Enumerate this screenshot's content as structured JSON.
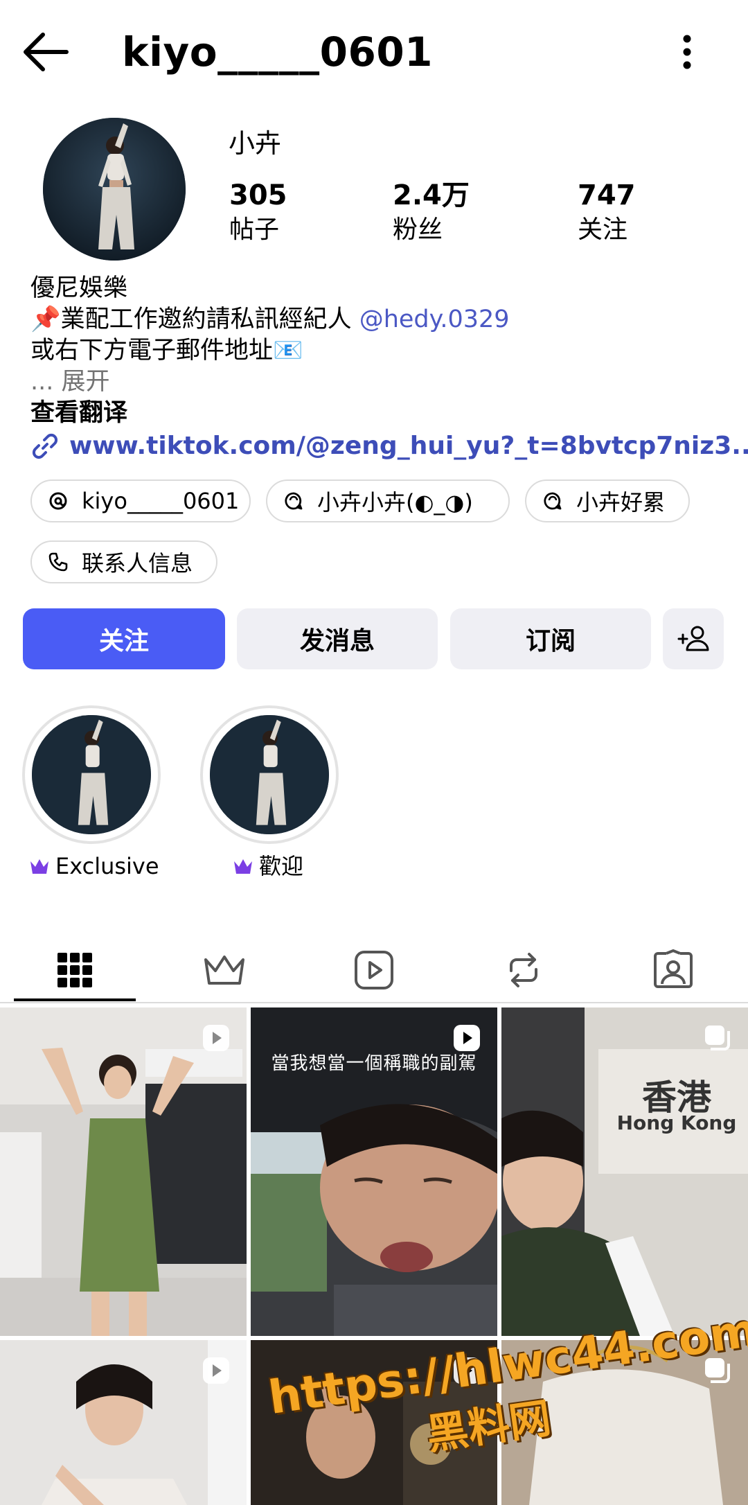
{
  "header": {
    "title": "kiyo_____0601"
  },
  "profile": {
    "display_name": "小卉",
    "stats": [
      {
        "value": "305",
        "label": "帖子"
      },
      {
        "value": "2.4万",
        "label": "粉丝"
      },
      {
        "value": "747",
        "label": "关注"
      }
    ],
    "bio": {
      "line1": "優尼娛樂",
      "line2_prefix": "📌業配工作邀約請私訊經紀人 ",
      "line2_mention": "@hedy.0329",
      "line3": "或右下方電子郵件地址📧",
      "more_prefix": "... ",
      "more_label": "展开",
      "translate": "查看翻译"
    },
    "link": "www.tiktok.com/@zeng_hui_yu?_t=8bvtcp7niz3..."
  },
  "chips": [
    {
      "icon": "threads-icon",
      "label": "kiyo_____0601"
    },
    {
      "icon": "chat-bubble-icon",
      "label": "小卉小卉(◐_◑)"
    },
    {
      "icon": "chat-bubble-icon",
      "label": "小卉好累"
    },
    {
      "icon": "phone-icon",
      "label": "联系人信息"
    }
  ],
  "actions": {
    "follow": "关注",
    "message": "发消息",
    "subscribe": "订阅"
  },
  "highlights": [
    {
      "label": "Exclusive",
      "icon": "crown-icon"
    },
    {
      "label": "歡迎",
      "icon": "crown-icon"
    }
  ],
  "tabs": [
    "grid-icon",
    "crown-icon",
    "reels-icon",
    "repost-icon",
    "tagged-icon"
  ],
  "grid": {
    "overlay_text": "當我想當一個稱職的副駕",
    "sign_cn": "香港",
    "sign_en": "Hong Kong"
  },
  "watermark": {
    "url": "https://hlwc44.com",
    "cn": "黑料网"
  },
  "colors": {
    "accent": "#4a5cf5",
    "secondary_button": "#efeff4",
    "crown": "#7b3fe4",
    "link": "#3d4db8"
  }
}
